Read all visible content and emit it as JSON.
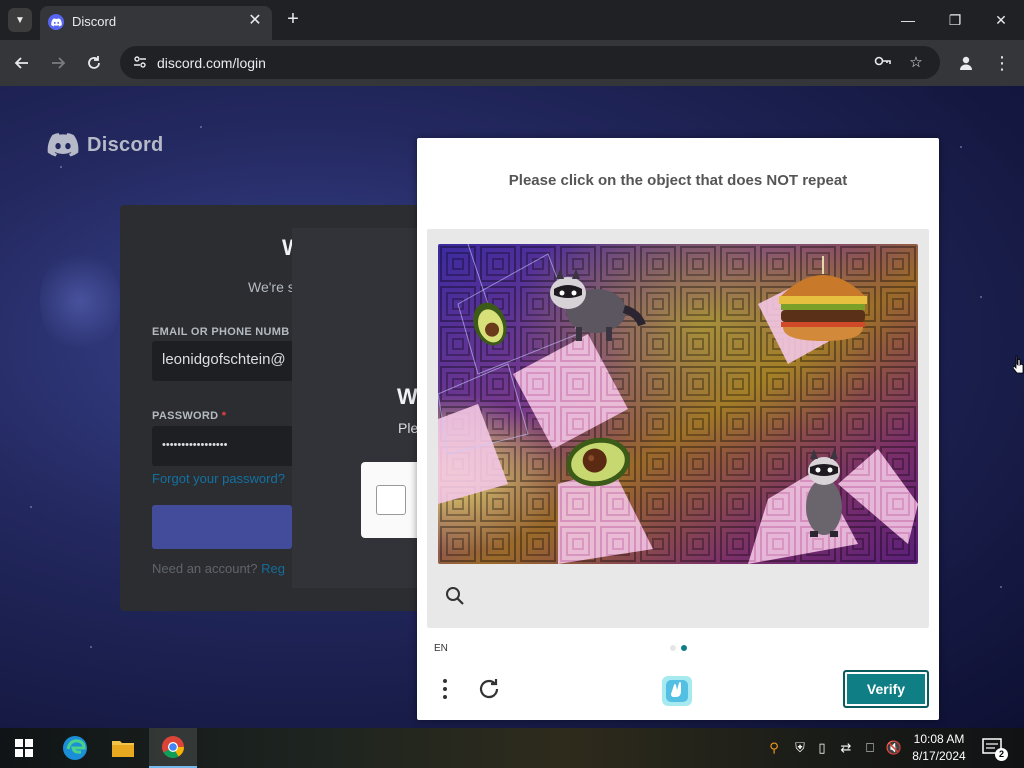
{
  "browser": {
    "tab": {
      "title": "Discord"
    },
    "omnibox": {
      "url": "discord.com/login"
    },
    "window_controls": {
      "minimize": "—",
      "restore": "❐",
      "close": "✕"
    }
  },
  "discord_page": {
    "logo_text": "Discord",
    "login": {
      "title": "W",
      "subtitle": "We're s",
      "email_label": "EMAIL OR PHONE NUMB",
      "email_value": "leonidgofschtein@",
      "password_label": "PASSWORD",
      "required_mark": "*",
      "password_value": "•••••••••••••••••",
      "forgot_password": "Forgot your password?",
      "need_account": "Need an account?",
      "register": "Reg"
    },
    "overlay": {
      "title": "W",
      "subtitle": "Ple"
    }
  },
  "captcha": {
    "prompt": "Please click on the object that does NOT repeat",
    "language": "EN",
    "verify_label": "Verify",
    "page_count": 2,
    "current_page": 2,
    "image_objects": [
      "avocado",
      "raccoon",
      "hamburger",
      "avocado",
      "raccoon"
    ],
    "colors": {
      "accent": "#0f7f85",
      "dot_active": "#0f7f85",
      "dot_inactive": "#e0e0e0"
    }
  },
  "taskbar": {
    "apps": [
      "start-icon",
      "edge-icon",
      "file-explorer-icon",
      "chrome-icon"
    ],
    "clock": {
      "time": "10:08 AM",
      "date": "8/17/2024"
    },
    "notifications_count": "2"
  }
}
